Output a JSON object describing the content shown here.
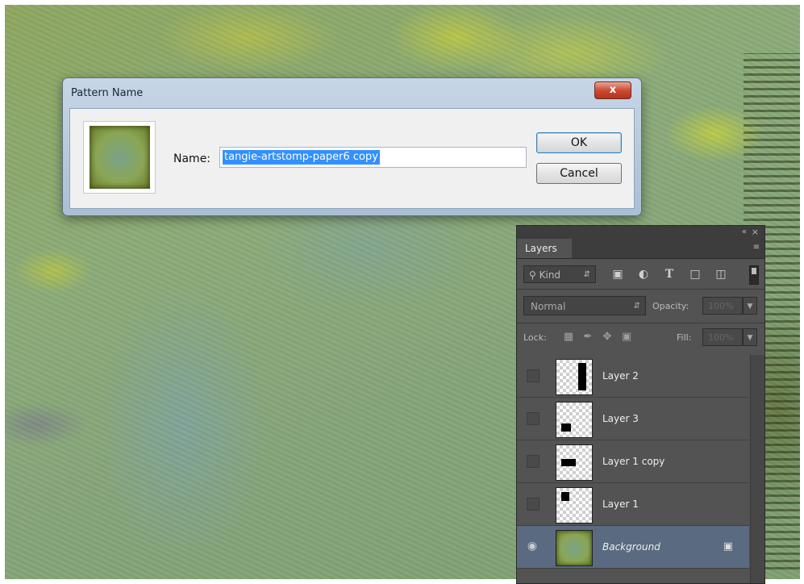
{
  "dialog": {
    "title": "Pattern Name",
    "close_label": "x",
    "name_label": "Name:",
    "name_value": "tangie-artstomp-paper6 copy",
    "ok_label": "OK",
    "cancel_label": "Cancel"
  },
  "panel": {
    "tab_label": "Layers",
    "collapse_glyph": "«",
    "close_glyph": "×",
    "menu_glyph": "≡",
    "filter_label": "Kind",
    "filter_icons": [
      "image-filter-icon",
      "adjustment-filter-icon",
      "type-filter-icon",
      "shape-filter-icon",
      "smart-object-filter-icon"
    ],
    "blend_mode": "Normal",
    "opacity_label": "Opacity:",
    "opacity_value": "100%",
    "lock_label": "Lock:",
    "fill_label": "Fill:",
    "fill_value": "100%",
    "layers": [
      {
        "name": "Layer 2",
        "visible": false
      },
      {
        "name": "Layer 3",
        "visible": false
      },
      {
        "name": "Layer 1 copy",
        "visible": false
      },
      {
        "name": "Layer 1",
        "visible": false
      },
      {
        "name": "Background",
        "visible": true,
        "selected": true,
        "locked": true
      }
    ]
  }
}
